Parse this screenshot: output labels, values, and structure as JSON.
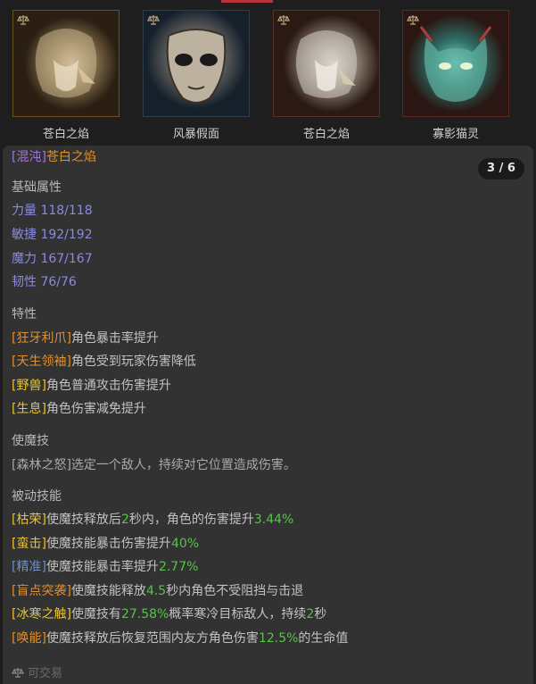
{
  "cards": [
    {
      "name": "苍白之焰",
      "bg": "#2a1f12",
      "border": "#6b5020"
    },
    {
      "name": "风暴假面",
      "bg": "#15202b",
      "border": "#2e3b4a"
    },
    {
      "name": "苍白之焰",
      "bg": "#2b1a14",
      "border": "#5a2f25"
    },
    {
      "name": "寡影猫灵",
      "bg": "#2a1612",
      "border": "#5a2a20"
    }
  ],
  "detail": {
    "title_tag": "[混沌]",
    "title_name": "苍白之焰",
    "page": "3 / 6",
    "base_header": "基础属性",
    "stats": [
      "力量 118/118",
      "敏捷 192/192",
      "魔力 167/167",
      "韧性 76/76"
    ],
    "traits_header": "特性",
    "traits": [
      {
        "tag": "[狂牙利爪]",
        "text": "角色暴击率提升"
      },
      {
        "tag": "[天生领袖]",
        "text": "角色受到玩家伤害降低"
      },
      {
        "tag": "[野兽]",
        "text": "角色普通攻击伤害提升"
      },
      {
        "tag": "[生息]",
        "text": "角色伤害减免提升"
      }
    ],
    "skill_header": "使魔技",
    "skill_text": "[森林之怒]选定一个敌人，持续对它位置造成伤害。",
    "passive_header": "被动技能",
    "passives": [
      {
        "tag": "[枯荣]",
        "parts": [
          "使魔技释放后",
          "2",
          "秒内，角色的伤害提升",
          "3.44%"
        ]
      },
      {
        "tag": "[蛮击]",
        "parts": [
          "使魔技能暴击伤害提升",
          "40%"
        ]
      },
      {
        "tag": "[精准]",
        "parts": [
          "使魔技能暴击率提升",
          "2.77%"
        ]
      },
      {
        "tag": "[盲点突袭]",
        "parts": [
          "使魔技能释放",
          "4.5",
          "秒内角色不受阻挡与击退"
        ]
      },
      {
        "tag": "[冰寒之触]",
        "parts": [
          "使魔技有",
          "27.58%",
          "概率寒冷目标敌人，持续",
          "2",
          "秒"
        ]
      },
      {
        "tag": "[唤能]",
        "parts": [
          "使魔技释放后恢复范围内友方角色伤害",
          "12.5%",
          "的生命值"
        ]
      }
    ],
    "footer": "可交易"
  }
}
